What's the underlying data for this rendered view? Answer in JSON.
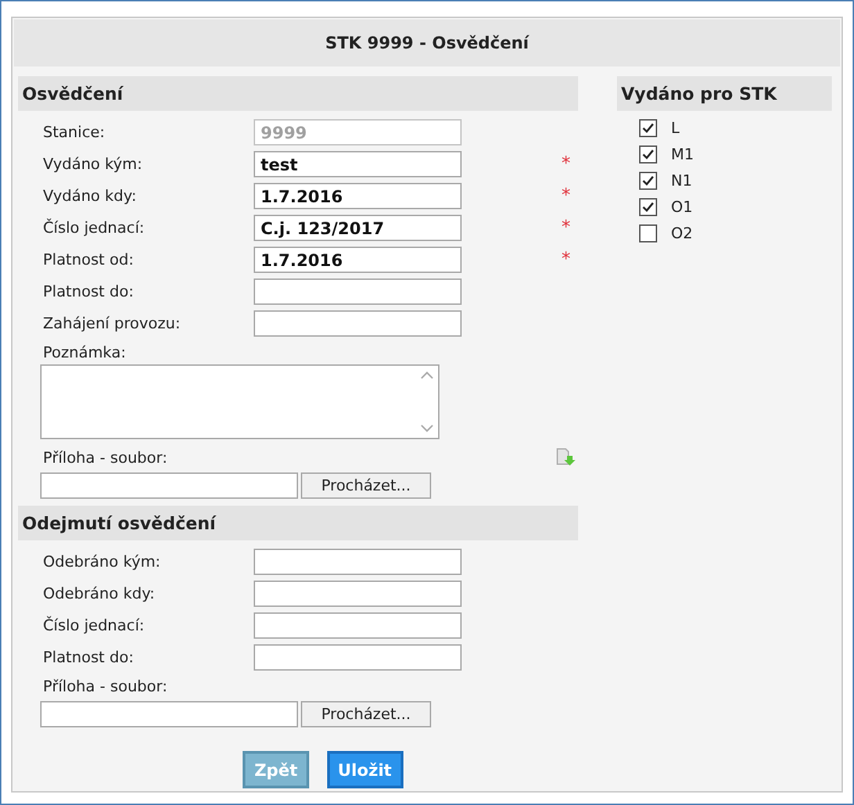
{
  "title": "STK 9999 - Osvědčení",
  "certificate": {
    "heading": "Osvědčení",
    "fields": [
      {
        "label": "Stanice:",
        "value": "9999",
        "disabled": true
      },
      {
        "label": "Vydáno kým:",
        "value": "test",
        "disabled": false,
        "marker": "*"
      },
      {
        "label": "Vydáno kdy:",
        "value": "1.7.2016",
        "disabled": false,
        "marker": "*"
      },
      {
        "label": "Číslo jednací:",
        "value": "C.j. 123/2017",
        "disabled": false,
        "marker": "*"
      },
      {
        "label": "Platnost od:",
        "value": "1.7.2016",
        "disabled": false,
        "marker": "*"
      },
      {
        "label": "Platnost do:",
        "disabled": false
      },
      {
        "label": "Zahájení provozu:",
        "disabled": false
      }
    ],
    "note": {
      "label": "Poznámka:"
    },
    "attachment": {
      "label": "Příloha - soubor:",
      "button": "Procházet..."
    }
  },
  "revocation": {
    "heading": "Odejmutí osvědčení",
    "fields": [
      {
        "label": "Odebráno kým:",
        "disabled": false
      },
      {
        "label": "Odebráno kdy:",
        "disabled": false
      },
      {
        "label": "Číslo jednací:",
        "disabled": false
      },
      {
        "label": "Platnost do:",
        "disabled": false
      }
    ],
    "attachment": {
      "label": "Příloha - soubor:",
      "button": "Procházet..."
    }
  },
  "issued_for": {
    "heading": "Vydáno pro STK",
    "items": [
      {
        "label": "L",
        "checked": true
      },
      {
        "label": "M1",
        "checked": true
      },
      {
        "label": "N1",
        "checked": true
      },
      {
        "label": "O1",
        "checked": true
      },
      {
        "label": "O2",
        "checked": false
      }
    ]
  },
  "buttons": [
    {
      "label": "Zpět",
      "kind": "secondary"
    },
    {
      "label": "Uložit",
      "kind": "primary"
    }
  ]
}
